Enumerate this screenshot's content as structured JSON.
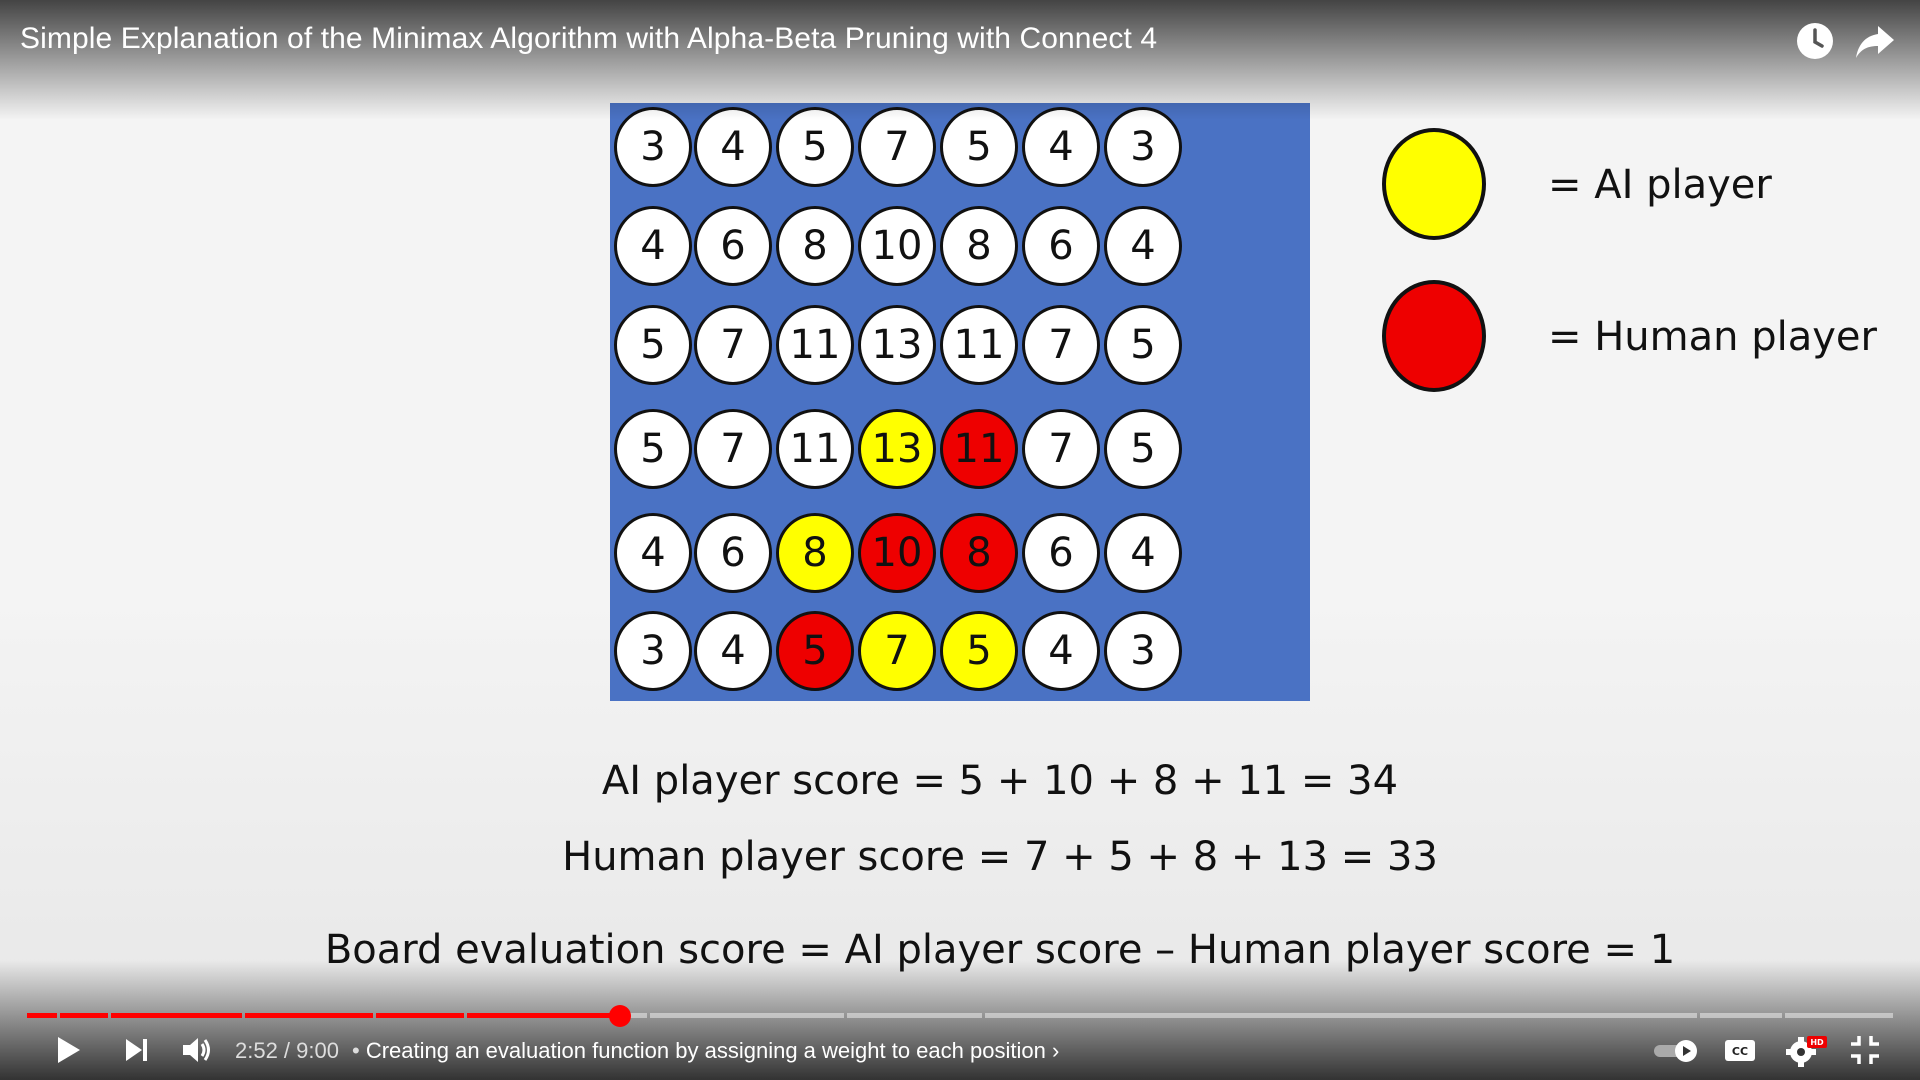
{
  "video": {
    "title": "Simple Explanation of the Minimax Algorithm with Alpha-Beta Pruning with Connect 4"
  },
  "board": {
    "rows": [
      [
        {
          "v": "3",
          "c": "white"
        },
        {
          "v": "4",
          "c": "white"
        },
        {
          "v": "5",
          "c": "white"
        },
        {
          "v": "7",
          "c": "white"
        },
        {
          "v": "5",
          "c": "white"
        },
        {
          "v": "4",
          "c": "white"
        },
        {
          "v": "3",
          "c": "white"
        }
      ],
      [
        {
          "v": "4",
          "c": "white"
        },
        {
          "v": "6",
          "c": "white"
        },
        {
          "v": "8",
          "c": "white"
        },
        {
          "v": "10",
          "c": "white"
        },
        {
          "v": "8",
          "c": "white"
        },
        {
          "v": "6",
          "c": "white"
        },
        {
          "v": "4",
          "c": "white"
        }
      ],
      [
        {
          "v": "5",
          "c": "white"
        },
        {
          "v": "7",
          "c": "white"
        },
        {
          "v": "11",
          "c": "white"
        },
        {
          "v": "13",
          "c": "white"
        },
        {
          "v": "11",
          "c": "white"
        },
        {
          "v": "7",
          "c": "white"
        },
        {
          "v": "5",
          "c": "white"
        }
      ],
      [
        {
          "v": "5",
          "c": "white"
        },
        {
          "v": "7",
          "c": "white"
        },
        {
          "v": "11",
          "c": "white"
        },
        {
          "v": "13",
          "c": "yellow"
        },
        {
          "v": "11",
          "c": "red"
        },
        {
          "v": "7",
          "c": "white"
        },
        {
          "v": "5",
          "c": "white"
        }
      ],
      [
        {
          "v": "4",
          "c": "white"
        },
        {
          "v": "6",
          "c": "white"
        },
        {
          "v": "8",
          "c": "yellow"
        },
        {
          "v": "10",
          "c": "red"
        },
        {
          "v": "8",
          "c": "red"
        },
        {
          "v": "6",
          "c": "white"
        },
        {
          "v": "4",
          "c": "white"
        }
      ],
      [
        {
          "v": "3",
          "c": "white"
        },
        {
          "v": "4",
          "c": "white"
        },
        {
          "v": "5",
          "c": "red"
        },
        {
          "v": "7",
          "c": "yellow"
        },
        {
          "v": "5",
          "c": "yellow"
        },
        {
          "v": "4",
          "c": "white"
        },
        {
          "v": "3",
          "c": "white"
        }
      ]
    ],
    "colors": {
      "background": "#4a72c4",
      "yellow": "#ffff00",
      "red": "#ee0000",
      "white": "#ffffff"
    }
  },
  "legend": {
    "ai_label": "= AI player",
    "human_label": "= Human player"
  },
  "scores": {
    "ai": "AI player score = 5 + 10 + 8 + 11 = 34",
    "human": "Human player score = 7 + 5 + 8 + 13 =  33",
    "evaluation": "Board evaluation score = AI player score – Human player score = 1"
  },
  "player": {
    "time": "2:52 / 9:00",
    "chapter_separator": "•",
    "chapter": "Creating an evaluation function by assigning a weight to each position",
    "chapter_arrow": "›",
    "progress_fraction": 0.318,
    "accent": "#ff0000",
    "icons": [
      "play-icon",
      "next-icon",
      "volume-icon",
      "autoplay-toggle-icon",
      "captions-icon",
      "settings-hd-icon",
      "exit-fullscreen-icon",
      "watch-later-icon",
      "share-icon"
    ]
  }
}
